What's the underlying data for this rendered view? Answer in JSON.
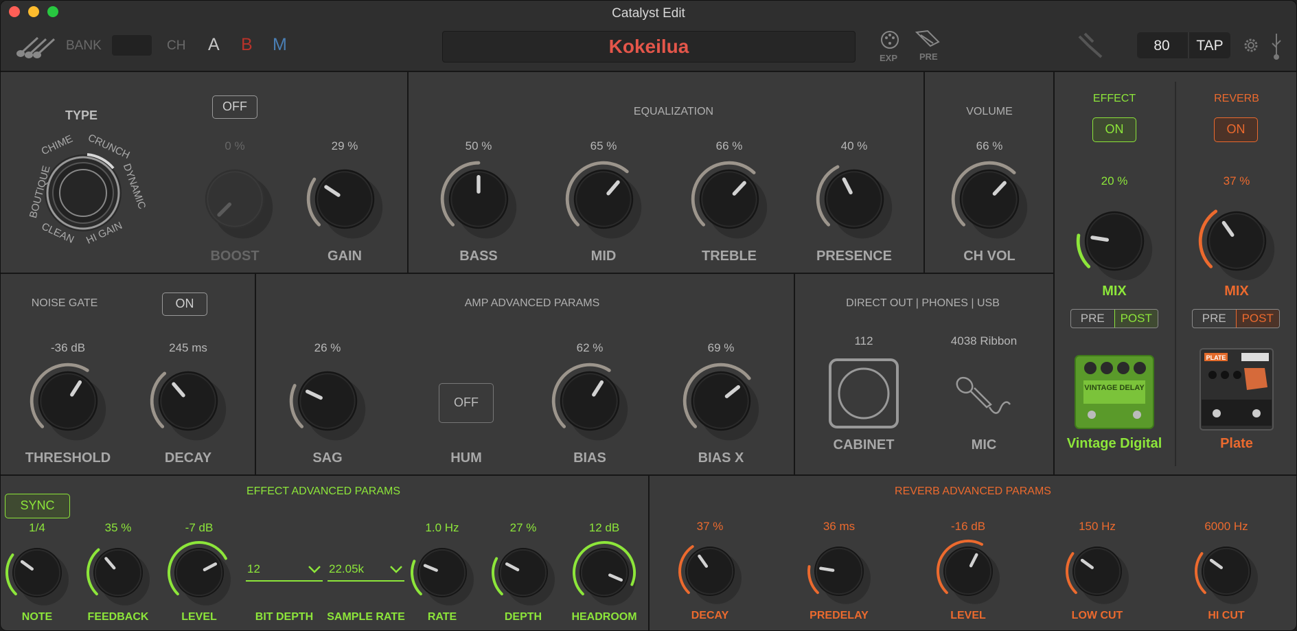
{
  "window": {
    "title": "Catalyst Edit"
  },
  "toolbar": {
    "bank_label": "BANK",
    "ch_label": "CH",
    "ch_a": "A",
    "ch_b": "B",
    "ch_m": "M",
    "preset_name": "Kokeilua",
    "exp_label": "EXP",
    "pre_label": "PRE",
    "tempo": "80",
    "tap_label": "TAP"
  },
  "amp": {
    "type_title": "TYPE",
    "type_options": [
      "CHIME",
      "CRUNCH",
      "DYNAMIC",
      "HI GAIN",
      "CLEAN",
      "BOUTIQUE"
    ],
    "boost_button": "OFF",
    "boost": {
      "value": "0 %",
      "label": "BOOST"
    },
    "gain": {
      "value": "29 %",
      "label": "GAIN"
    },
    "eq_title": "EQUALIZATION",
    "bass": {
      "value": "50 %",
      "label": "BASS"
    },
    "mid": {
      "value": "65 %",
      "label": "MID"
    },
    "treble": {
      "value": "66 %",
      "label": "TREBLE"
    },
    "presence": {
      "value": "40 %",
      "label": "PRESENCE"
    },
    "volume_title": "VOLUME",
    "chvol": {
      "value": "66 %",
      "label": "CH VOL"
    }
  },
  "gate": {
    "title": "NOISE GATE",
    "button": "ON",
    "threshold": {
      "value": "-36 dB",
      "label": "THRESHOLD"
    },
    "decay": {
      "value": "245 ms",
      "label": "DECAY"
    }
  },
  "adv": {
    "title": "AMP ADVANCED PARAMS",
    "sag": {
      "value": "26 %",
      "label": "SAG"
    },
    "hum": {
      "button": "OFF",
      "label": "HUM"
    },
    "bias": {
      "value": "62 %",
      "label": "BIAS"
    },
    "biasx": {
      "value": "69 %",
      "label": "BIAS X"
    }
  },
  "direct": {
    "title": "DIRECT OUT | PHONES | USB",
    "cab_value": "112",
    "cab_label": "CABINET",
    "mic_value": "4038 Ribbon",
    "mic_label": "MIC"
  },
  "effect": {
    "title": "EFFECT",
    "button": "ON",
    "mix_value": "20 %",
    "mix_label": "MIX",
    "pre": "PRE",
    "post": "POST",
    "name": "Vintage Digital",
    "pedal_text": "VINTAGE DELAY"
  },
  "reverb": {
    "title": "REVERB",
    "button": "ON",
    "mix_value": "37 %",
    "mix_label": "MIX",
    "pre": "PRE",
    "post": "POST",
    "name": "Plate",
    "pedal_text": "PLATE"
  },
  "effect_adv": {
    "title": "EFFECT ADVANCED PARAMS",
    "sync": "SYNC",
    "note": {
      "value": "1/4",
      "label": "NOTE"
    },
    "feedback": {
      "value": "35 %",
      "label": "FEEDBACK"
    },
    "level": {
      "value": "-7 dB",
      "label": "LEVEL"
    },
    "bitdepth": {
      "value": "12",
      "label": "BIT DEPTH"
    },
    "samplerate": {
      "value": "22.05k",
      "label": "SAMPLE RATE"
    },
    "rate": {
      "value": "1.0 Hz",
      "label": "RATE"
    },
    "depth": {
      "value": "27 %",
      "label": "DEPTH"
    },
    "headroom": {
      "value": "12 dB",
      "label": "HEADROOM"
    }
  },
  "reverb_adv": {
    "title": "REVERB ADVANCED PARAMS",
    "decay": {
      "value": "37 %",
      "label": "DECAY"
    },
    "predelay": {
      "value": "36 ms",
      "label": "PREDELAY"
    },
    "level": {
      "value": "-16 dB",
      "label": "LEVEL"
    },
    "lowcut": {
      "value": "150 Hz",
      "label": "LOW CUT"
    },
    "hicut": {
      "value": "6000 Hz",
      "label": "HI CUT"
    }
  },
  "colors": {
    "accent_green": "#8de63a",
    "accent_orange": "#ec6a2e",
    "preset_red": "#e4564a",
    "ch_b": "#b8332a",
    "ch_m": "#4a7fb5"
  },
  "knob_levels": {
    "boost": 0,
    "gain": 0.29,
    "bass": 0.5,
    "mid": 0.65,
    "treble": 0.66,
    "presence": 0.4,
    "chvol": 0.66,
    "threshold": 0.62,
    "decay": 0.35,
    "sag": 0.26,
    "bias": 0.62,
    "biasx": 0.69,
    "eff_mix": 0.2,
    "rev_mix": 0.37,
    "note": 0.3,
    "feedback": 0.35,
    "level": 0.73,
    "rate": 0.25,
    "depth": 0.27,
    "headroom": 0.92,
    "rdecay": 0.37,
    "predelay": 0.2,
    "rlevel": 0.6,
    "lowcut": 0.3,
    "hicut": 0.3
  }
}
